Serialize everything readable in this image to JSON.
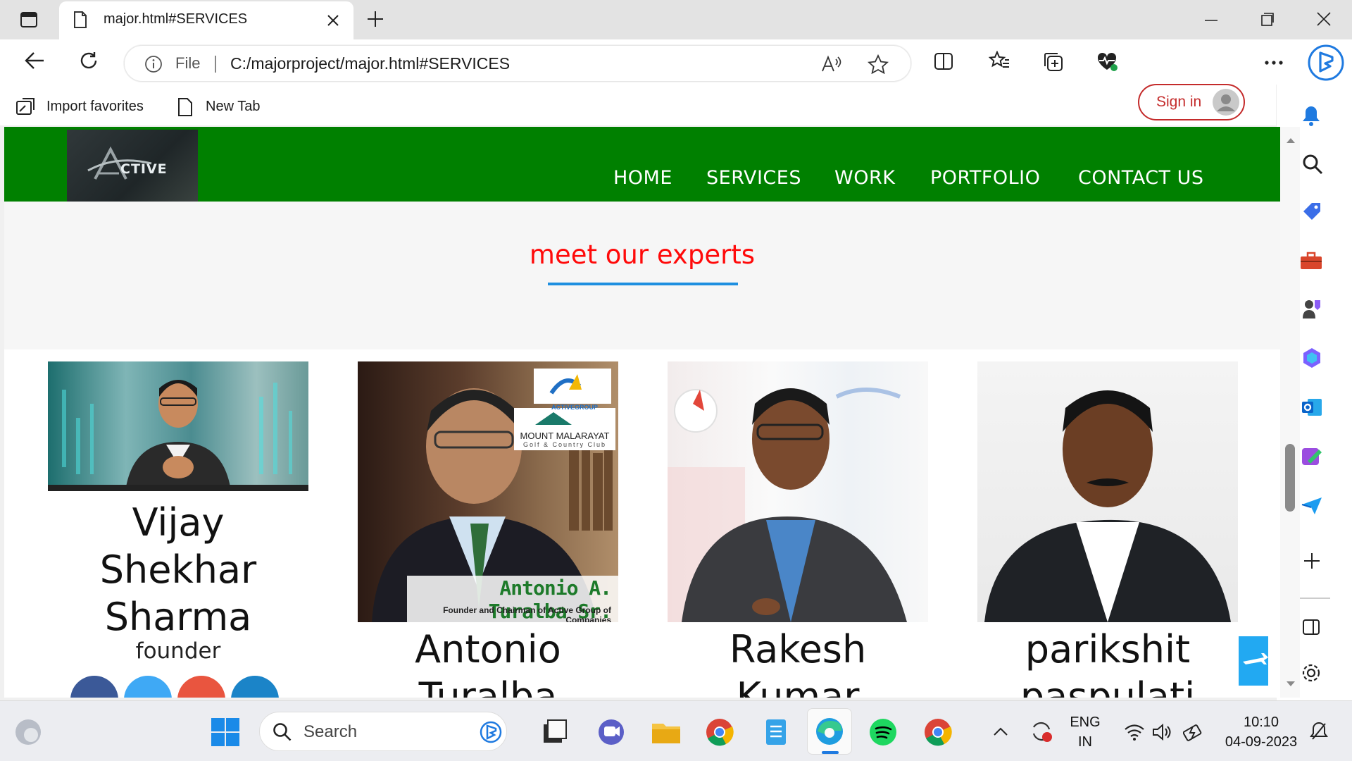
{
  "browser": {
    "tab_title": "major.html#SERVICES",
    "address_prefix": "File",
    "url": "C:/majorproject/major.html#SERVICES",
    "sign_in_label": "Sign in",
    "favorites": [
      {
        "label": "Import favorites",
        "icon": "import-favorites-icon"
      },
      {
        "label": "New Tab",
        "icon": "page-icon"
      }
    ]
  },
  "site": {
    "logo_text": "CTIVE",
    "nav": [
      "HOME",
      "SERVICES",
      "WORK",
      "PORTFOLIO",
      "CONTACT US"
    ],
    "nav_color": "#008000",
    "section_title": "meet our experts",
    "section_title_color": "#ff0a0a",
    "underline_color": "#1e8fe0",
    "experts": [
      {
        "name_lines": [
          "Vijay",
          "Shekhar",
          "Sharma"
        ],
        "role": "founder"
      },
      {
        "name_lines": [
          "Antonio",
          "Turalba"
        ],
        "photo_caption": "Antonio A. Turalba Sr.",
        "photo_subcaption": "Founder and Chairman of  Active Group of Companies",
        "photo_logo_1": "ACTIVEGROUP",
        "photo_logo_2": "MOUNT MALARAYAT",
        "photo_logo_3": "Golf & Country Club"
      },
      {
        "name_lines": [
          "Rakesh",
          "Kumar"
        ]
      },
      {
        "name_lines": [
          "parikshit",
          "paspulati"
        ]
      }
    ]
  },
  "taskbar": {
    "search_label": "Search",
    "language": [
      "ENG",
      "IN"
    ],
    "time": "10:10",
    "date": "04-09-2023"
  }
}
